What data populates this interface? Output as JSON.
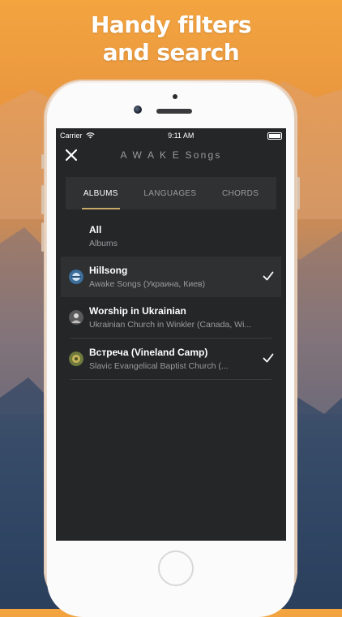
{
  "headline": {
    "line1": "Handy filters",
    "line2": "and search"
  },
  "statusbar": {
    "carrier": "Carrier",
    "time": "9:11 AM"
  },
  "navbar": {
    "title": "A W A K E Songs"
  },
  "tabs": [
    {
      "label": "ALBUMS",
      "active": true
    },
    {
      "label": "LANGUAGES",
      "active": false
    },
    {
      "label": "CHORDS",
      "active": false
    }
  ],
  "rows": [
    {
      "title": "All",
      "subtitle": "Albums",
      "checked": false,
      "selected": false
    },
    {
      "title": "Hillsong",
      "subtitle": "Awake Songs (Украина, Киев)",
      "checked": true,
      "selected": true
    },
    {
      "title": "Worship in Ukrainian",
      "subtitle": "Ukrainian Church in Winkler (Canada, Wi...",
      "checked": false,
      "selected": false
    },
    {
      "title": "Встреча (Vineland Camp)",
      "subtitle": "Slavic Evangelical Baptist Church (...",
      "checked": true,
      "selected": false
    }
  ],
  "colors": {
    "accent": "#c9a86a",
    "screen_bg": "#242628",
    "selected_row_bg": "#2e3032"
  }
}
